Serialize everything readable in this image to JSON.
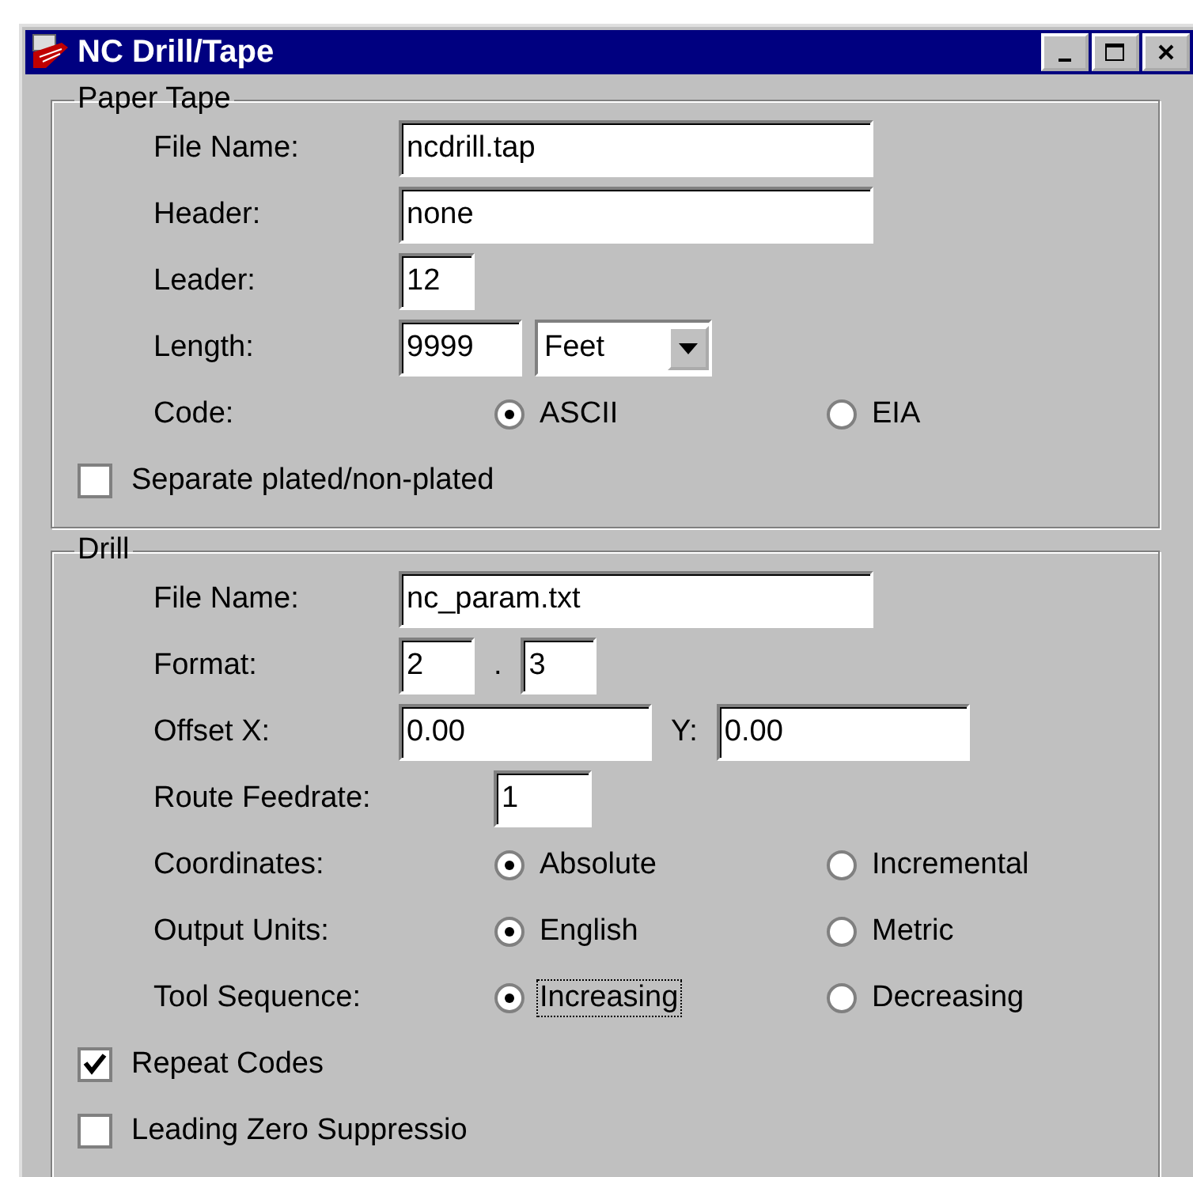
{
  "window": {
    "title": "NC Drill/Tape"
  },
  "groups": [
    {
      "title": "Paper Tape",
      "rows": [
        {
          "kind": "field",
          "label": "File Name:",
          "fields": [
            {
              "kind": "wide",
              "value": "ncdrill.tap"
            }
          ]
        },
        {
          "kind": "field",
          "label": "Header:",
          "fields": [
            {
              "kind": "wide",
              "value": "none"
            }
          ]
        },
        {
          "kind": "field",
          "label": "Leader:",
          "fields": [
            {
              "kind": "tiny",
              "value": "12"
            }
          ]
        },
        {
          "kind": "field",
          "label": "Length:",
          "fields": [
            {
              "kind": "small",
              "value": "9999"
            },
            {
              "kind": "select",
              "value": "Feet"
            }
          ]
        },
        {
          "kind": "radio",
          "label": "Code:",
          "options": [
            {
              "label": "ASCII",
              "selected": true,
              "focused": false
            },
            {
              "label": "EIA",
              "selected": false,
              "focused": false
            }
          ]
        },
        {
          "kind": "checkbox",
          "label": "Separate plated/non-plated",
          "checked": false
        }
      ]
    },
    {
      "title": "Drill",
      "rows": [
        {
          "kind": "field",
          "label": "File Name:",
          "fields": [
            {
              "kind": "wide",
              "value": "nc_param.txt"
            }
          ]
        },
        {
          "kind": "field",
          "label": "Format:",
          "fields": [
            {
              "kind": "tiny",
              "value": "2"
            },
            {
              "kind": "text",
              "value": "."
            },
            {
              "kind": "tiny",
              "value": "3"
            }
          ]
        },
        {
          "kind": "field",
          "label": "Offset X:",
          "fields": [
            {
              "kind": "mid",
              "value": "0.00"
            },
            {
              "kind": "text",
              "value": "Y:"
            },
            {
              "kind": "mid",
              "value": "0.00"
            }
          ]
        },
        {
          "kind": "field",
          "label": "Route Feedrate:",
          "fields": [
            {
              "kind": "feed",
              "value": "1"
            }
          ]
        },
        {
          "kind": "radio",
          "label": "Coordinates:",
          "options": [
            {
              "label": "Absolute",
              "selected": true,
              "focused": false
            },
            {
              "label": "Incremental",
              "selected": false,
              "focused": false
            }
          ]
        },
        {
          "kind": "radio",
          "label": "Output Units:",
          "options": [
            {
              "label": "English",
              "selected": true,
              "focused": false
            },
            {
              "label": "Metric",
              "selected": false,
              "focused": false
            }
          ]
        },
        {
          "kind": "radio",
          "label": "Tool Sequence:",
          "options": [
            {
              "label": "Increasing",
              "selected": true,
              "focused": true
            },
            {
              "label": "Decreasing",
              "selected": false,
              "focused": false
            }
          ]
        },
        {
          "kind": "checkbox",
          "label": "Repeat Codes",
          "checked": true
        },
        {
          "kind": "checkbox",
          "label": "Leading Zero Suppressio",
          "checked": false
        }
      ]
    }
  ]
}
